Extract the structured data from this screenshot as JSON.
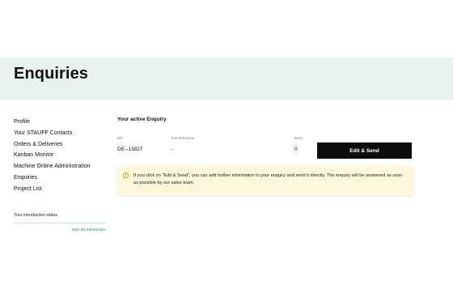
{
  "page": {
    "title": "Enquiries"
  },
  "sidebar": {
    "items": [
      {
        "label": "Profile"
      },
      {
        "label": "Your STAUFF Contacts"
      },
      {
        "label": "Orders & Deliveries"
      },
      {
        "label": "Kanban Monitor"
      },
      {
        "label": "Machine Online Administration"
      },
      {
        "label": "Enquiries"
      },
      {
        "label": "Project List"
      }
    ],
    "intro": {
      "label": "Your introduction status",
      "progress_fraction": 0,
      "link": "Start the introduction"
    }
  },
  "main": {
    "section_title": "Your active Enquiry",
    "table": {
      "headers": {
        "id": "ID#",
        "reference": "Your Reference",
        "items": "Items"
      },
      "row": {
        "id": "DE--13827",
        "reference": "-",
        "items": "0"
      }
    },
    "edit_button": "Edit & Send",
    "notice": {
      "icon": "info-icon",
      "text": "If you click on \"Edit & Send\", you can add further information to your enquiry and send it directly. The enquiry will be answered as soon as possible by our sales team."
    }
  }
}
